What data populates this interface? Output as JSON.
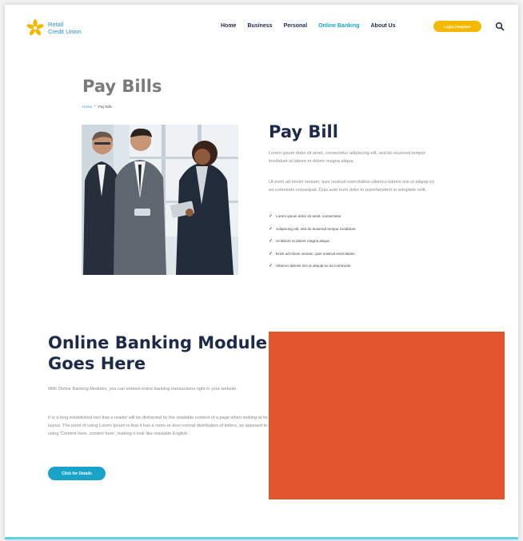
{
  "brand": {
    "line1": "Retail",
    "line2": "Credit Union"
  },
  "nav": {
    "items": [
      {
        "label": "Home",
        "active": false
      },
      {
        "label": "Business",
        "active": false
      },
      {
        "label": "Personal",
        "active": false
      },
      {
        "label": "Online Banking",
        "active": true
      },
      {
        "label": "About Us",
        "active": false
      }
    ],
    "login_label": "Login | Register",
    "search_icon": "search-icon"
  },
  "page": {
    "title": "Pay Bills",
    "breadcrumb": {
      "home": "Home",
      "separator": "›",
      "current": "Pay Bills"
    }
  },
  "pay_bill": {
    "heading": "Pay Bill",
    "paragraph1": "Lorem ipsum dolor sit amet, consectetur adipiscing elit, sed do eiusmod tempor incididunt ut labore et dolore magna aliqua.",
    "paragraph2": "Ut enim ad minim veniam, quis nostrud exercitation ullamco laboris nisi ut aliquip ex ea commodo consequat. Duis aute irure dolor in reprehenderit in voluptate velit.",
    "checklist": [
      "Lorem ipsum dolor sit amet, consectetur",
      "Adipiscing elit, sed do eiusmod tempor incididunt",
      "Ut labore et dolore magna aliqua",
      "Enim ad minim veniam, quis nostrud exercitation",
      "Ullamco laboris nisi ut aliquip ex ea commodo"
    ]
  },
  "online_banking": {
    "heading": "Online Banking Module Goes Here",
    "paragraph1": "With Online Banking Modules, you can embed online banking transactions right in your website.",
    "paragraph2": "It is a long established fact that a reader will be distracted by the readable content of a page when looking at its layout. The point of using Lorem Ipsum is that it has a more-or-less normal distribution of letters, as opposed to using 'Content here, content here', making it look like readable English.",
    "button_label": "Click for Details"
  },
  "colors": {
    "accent": "#1aa3c9",
    "navy": "#1d2a4a",
    "login": "#f5b800",
    "module": "#e2542b",
    "footer_line": "#5ed3e3"
  }
}
